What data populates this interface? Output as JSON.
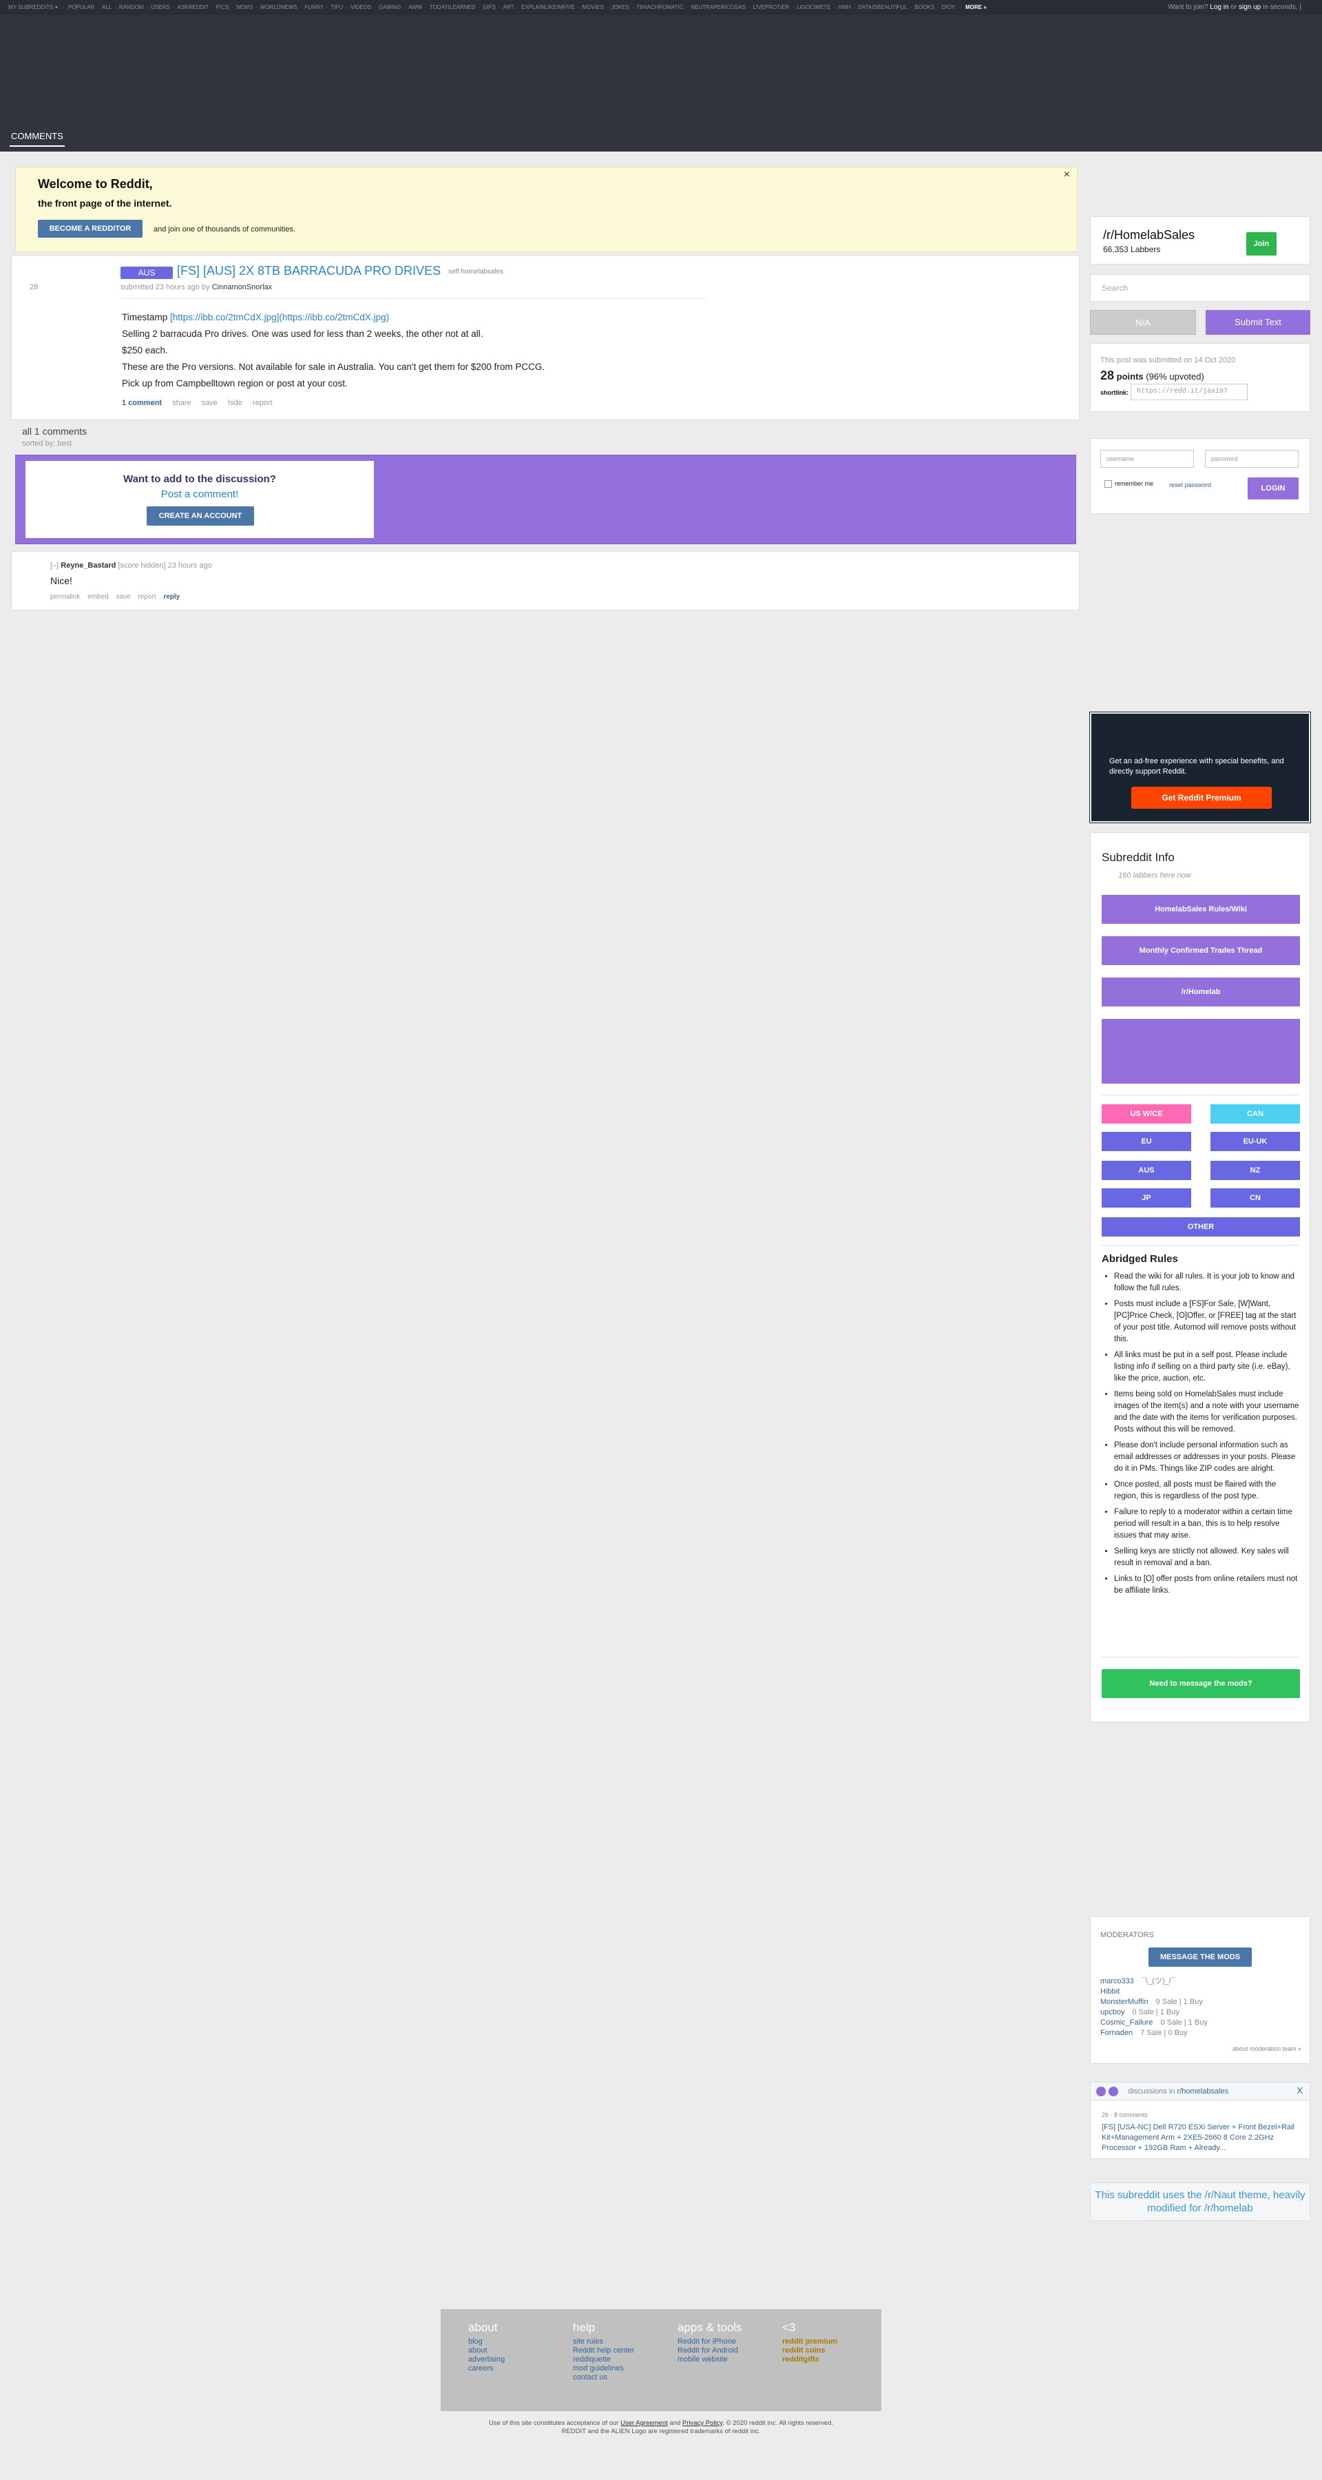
{
  "topbar": {
    "my_subreddits": "MY SUBREDDITS",
    "subs": [
      "POPULAR",
      "ALL",
      "RANDOM",
      "USERS",
      "ASKREDDIT",
      "PICS",
      "NEWS",
      "WORLDNEWS",
      "FUNNY",
      "TIFU",
      "VIDEOS",
      "GAMING",
      "AWW",
      "TODAYILEARNED",
      "GIFS",
      "ART",
      "EXPLAINLIKEIMFIVE",
      "MOVIES",
      "JOKES",
      "TIHIACHROMATIC",
      "NEUTRAPERICOSAS",
      "LIVEPROTIER",
      "LIGOCIMETE",
      "HMH",
      "DATAISBEAUTIFUL",
      "BOOKS",
      "DIOY"
    ],
    "more": "MORE »",
    "want_join": "Want to join?",
    "log_in": "Log in",
    "or": "or",
    "sign_up": "sign up",
    "seconds": "in seconds.",
    "sep": "|"
  },
  "header": {
    "tab": "COMMENTS"
  },
  "welcome": {
    "title": "Welcome to Reddit,",
    "subtitle": "the front page of the internet.",
    "button": "BECOME A REDDITOR",
    "join_text": "and join one of thousands of communities.",
    "close": "×"
  },
  "post": {
    "score": "28",
    "flair": "AUS",
    "title": "[FS] [AUS] 2X 8TB BARRACUDA PRO DRIVES",
    "domain": "self.homelabsales",
    "submitted": "submitted 23 hours ago by",
    "author": "CinnamonSnorlax",
    "timestamp_label": "Timestamp",
    "timestamp_link": "[https://ibb.co/2tmCdX.jpg](https://ibb.co/2tmCdX.jpg)",
    "lines": [
      "Selling 2 barracuda Pro drives. One was used for less than 2 weeks, the other not at all.",
      "$250 each.",
      "These are the Pro versions. Not available for sale in Australia. You can't get them for $200 from PCCG.",
      "Pick up from Campbelltown region or post at your cost."
    ],
    "actions": {
      "comments": "1 comment",
      "share": "share",
      "save": "save",
      "hide": "hide",
      "report": "report"
    }
  },
  "comments_header": {
    "all": "all 1 comments",
    "sorted": "sorted by: best"
  },
  "cta": {
    "question": "Want to add to the discussion?",
    "post": "Post a comment!",
    "create": "CREATE AN ACCOUNT"
  },
  "comment": {
    "toggle": "[–]",
    "author": "Reyne_Bastard",
    "meta": "[score hidden] 23 hours ago",
    "text": "Nice!",
    "actions": {
      "permalink": "permalink",
      "embed": "embed",
      "save": "save",
      "report": "report",
      "reply": "reply"
    }
  },
  "sidebar": {
    "subreddit": {
      "name": "/r/HomelabSales",
      "labbers": "66,353 Labbers",
      "join": "Join"
    },
    "search_placeholder": "Search",
    "na": "N/A",
    "submit_text": "Submit Text",
    "info": {
      "submitted": "This post was submitted on 14 Oct 2020",
      "points": "28",
      "points_label": "points",
      "upvoted": "(96% upvoted)",
      "shortlink_label": "shortlink:",
      "shortlink": "https://redd.it/jax197"
    },
    "login": {
      "username": "username",
      "password": "password",
      "remember": "remember me",
      "reset": "reset password",
      "button": "LOGIN"
    },
    "premium": {
      "text": "Get an ad-free experience with special benefits, and directly support Reddit.",
      "button": "Get Reddit Premium"
    },
    "subinfo": {
      "title": "Subreddit Info",
      "online": "160 labbers here now",
      "buttons": [
        "HomelabSales Rules/Wiki",
        "Monthly Confirmed Trades Thread",
        "/r/Homelab"
      ],
      "regions": [
        "US W/CE",
        "CAN",
        "EU",
        "EU-UK",
        "AUS",
        "NZ",
        "JP",
        "CN",
        "OTHER"
      ],
      "region_colors": {
        "uswce": "#ff69b4",
        "can": "#4dd0f0",
        "default": "#6a67e3"
      },
      "rules_title": "Abridged Rules",
      "rules": [
        "Read the wiki for all rules. It is your job to know and follow the full rules.",
        "Posts must include a [FS]For Sale, [W]Want, [PC]Price Check, [O]Offer, or [FREE] tag at the start of your post title. Automod will remove posts without this.",
        "All links must be put in a self post. Please include listing info if selling on a third party site (i.e. eBay), like the price, auction, etc.",
        "Items being sold on HomelabSales must include images of the item(s) and a note with your username and the date with the items for verification purposes. Posts without this will be removed.",
        "Please don't include personal information such as email addresses or addresses in your posts. Please do it in PMs. Things like ZIP codes are alright.",
        "Once posted, all posts must be flaired with the region, this is regardless of the post type.",
        "Failure to reply to a moderator within a certain time period will result in a ban, this is to help resolve issues that may arise.",
        "Selling keys are strictly not allowed. Key sales will result in removal and a ban.",
        "Links to [O] offer posts from online retailers must not be affiliate links."
      ],
      "message_mods": "Need to message the mods?"
    },
    "moderators": {
      "title": "MODERATORS",
      "button": "MESSAGE THE MODS",
      "list": [
        {
          "name": "marco333",
          "flair": "¯\\_(ツ)_/¯"
        },
        {
          "name": "Hibbit",
          "flair": ""
        },
        {
          "name": "MonsterMuffin",
          "flair": "9 Sale | 1 Buy"
        },
        {
          "name": "upcboy",
          "flair": "0 Sale | 1 Buy"
        },
        {
          "name": "Cosmic_Failure",
          "flair": "0 Sale | 1 Buy"
        },
        {
          "name": "Fornaden",
          "flair": "7 Sale | 0 Buy"
        }
      ],
      "about": "about moderation team »"
    },
    "discussions": {
      "header": "discussions in",
      "sub": "r/homelabsales",
      "close": "X",
      "meta": "26 · 8 comments",
      "link": "[FS] [USA-NC] Dell R720 ESXi Server + Front Bezel+Rail Kit+Management Arm + 2XE5-2660 8 Core 2.2GHz Processor + 192GB Ram + Already..."
    },
    "theme": "This subreddit uses the /r/Naut theme, heavily modified for /r/homelab"
  },
  "footer": {
    "about": {
      "title": "about",
      "links": [
        "blog",
        "about",
        "advertising",
        "careers"
      ]
    },
    "help": {
      "title": "help",
      "links": [
        "site rules",
        "Reddit help center",
        "reddiquette",
        "mod guidelines",
        "contact us"
      ]
    },
    "apps": {
      "title": "apps & tools",
      "links": [
        "Reddit for iPhone",
        "Reddit for Android",
        "mobile website"
      ]
    },
    "heart": {
      "title": "<3",
      "links": [
        "reddit premium",
        "reddit coins",
        "redditgifts"
      ]
    },
    "legal1_a": "Use of this site constitutes acceptance of our",
    "user_agreement": "User Agreement",
    "and": "and",
    "privacy": "Privacy Policy",
    "legal1_b": ". © 2020 reddit inc. All rights reserved.",
    "legal2": "REDDIT and the ALIEN Logo are registered trademarks of reddit inc."
  }
}
